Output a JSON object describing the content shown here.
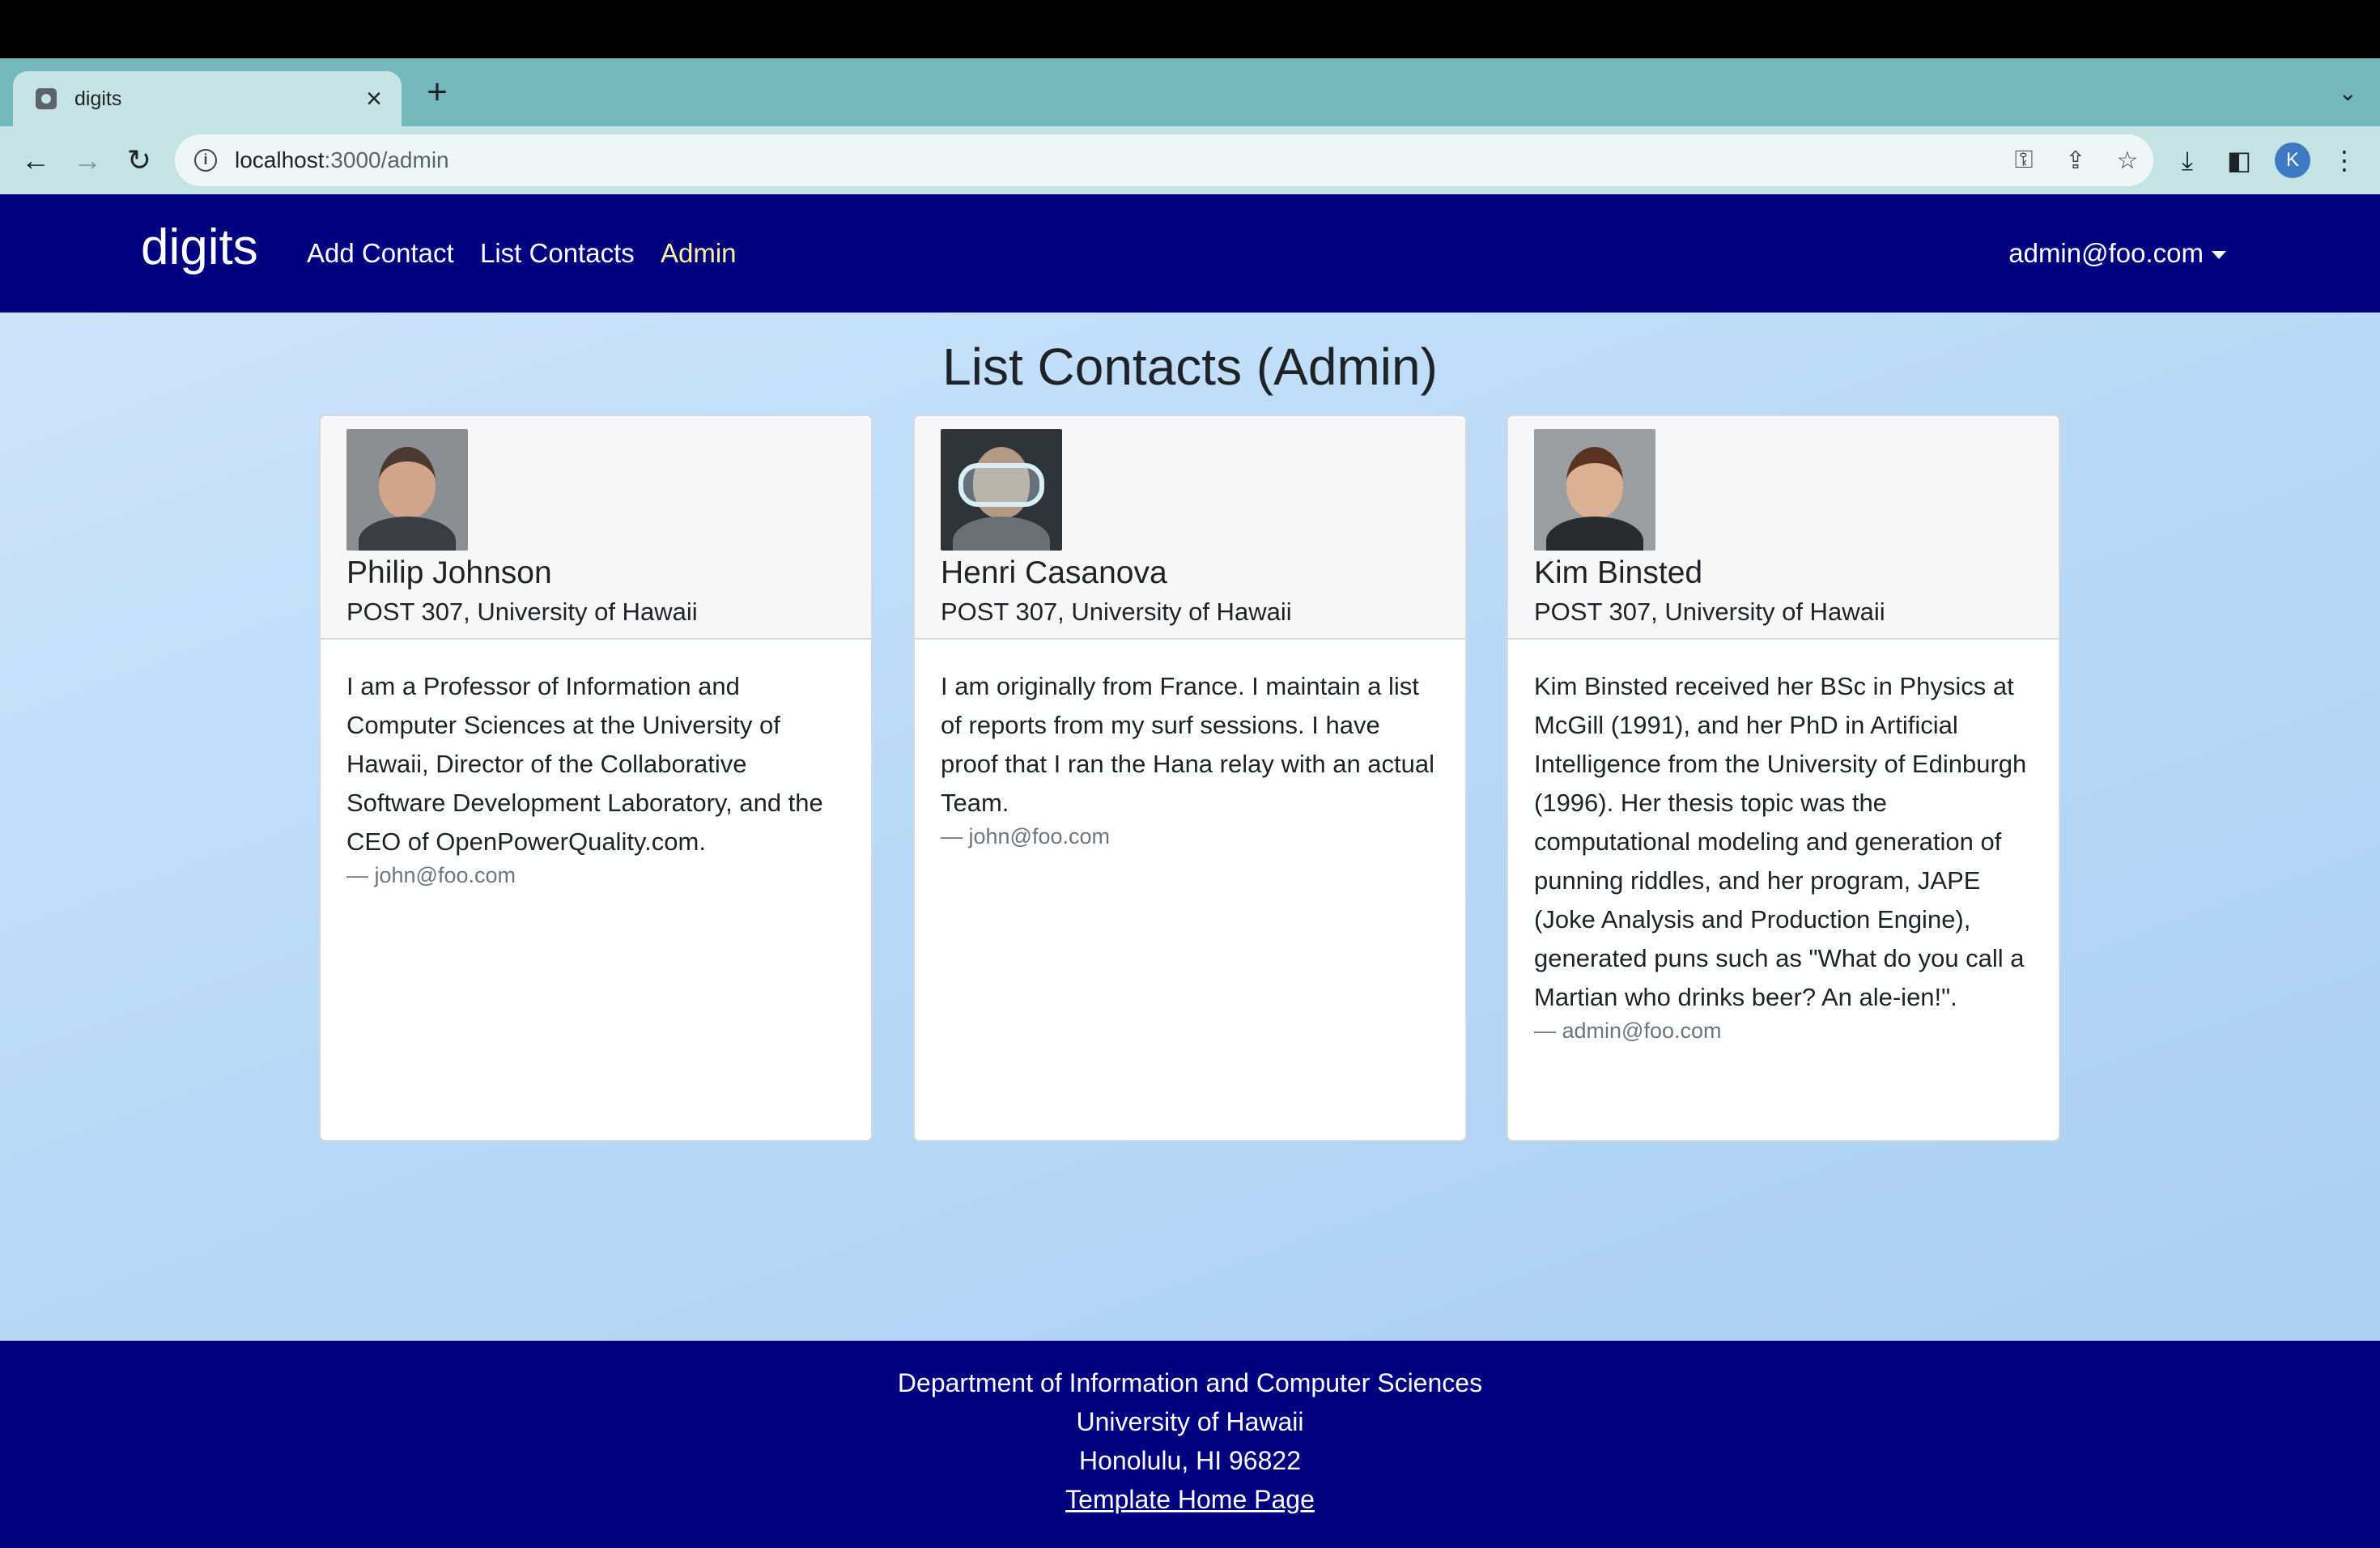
{
  "browser": {
    "tab_title": "digits",
    "url_host": "localhost",
    "url_path": ":3000/admin",
    "profile_initial": "K"
  },
  "navbar": {
    "brand": "digits",
    "links": [
      "Add Contact",
      "List Contacts",
      "Admin"
    ],
    "active_link": "Admin",
    "user": "admin@foo.com"
  },
  "main": {
    "title": "List Contacts (Admin)",
    "contacts": [
      {
        "name": "Philip Johnson",
        "address": "POST 307, University of Hawaii",
        "description": "I am a Professor of Information and Computer Sciences at the University of Hawaii, Director of the Collaborative Software Development Laboratory, and the CEO of OpenPowerQuality.com.",
        "owner": "— john@foo.com"
      },
      {
        "name": "Henri Casanova",
        "address": "POST 307, University of Hawaii",
        "description": "I am originally from France. I maintain a list of reports from my surf sessions. I have proof that I ran the Hana relay with an actual Team.",
        "owner": "— john@foo.com"
      },
      {
        "name": "Kim Binsted",
        "address": "POST 307, University of Hawaii",
        "description": "Kim Binsted received her BSc in Physics at McGill (1991), and her PhD in Artificial Intelligence from the University of Edinburgh (1996). Her thesis topic was the computational modeling and generation of punning riddles, and her program, JAPE (Joke Analysis and Production Engine), generated puns such as \"What do you call a Martian who drinks beer? An ale-ien!\".",
        "owner": "— admin@foo.com"
      }
    ]
  },
  "footer": {
    "line1": "Department of Information and Computer Sciences",
    "line2": "University of Hawaii",
    "line3": "Honolulu, HI 96822",
    "link": "Template Home Page"
  },
  "colors": {
    "navbar_bg": "#000080",
    "active_link": "#fcf29a",
    "tabstrip": "#74b7bd"
  }
}
